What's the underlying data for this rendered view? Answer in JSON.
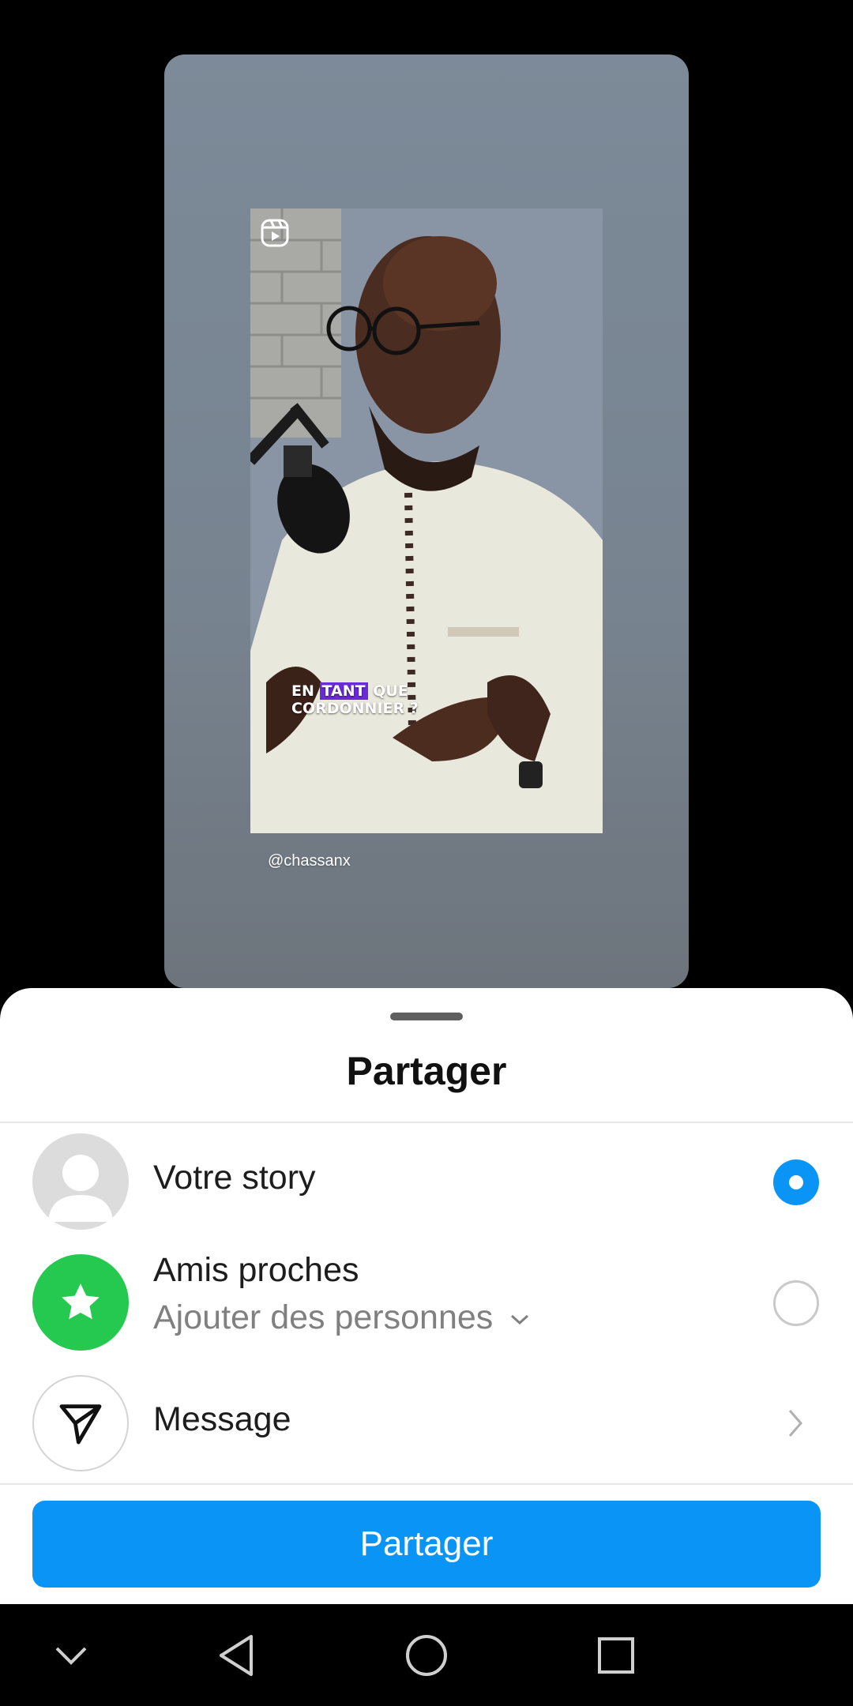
{
  "story_preview": {
    "caption_pre": "EN",
    "caption_highlight": "TANT",
    "caption_post": "QUE",
    "caption_line2": "CORDONNIER ?",
    "username": "@chassanx"
  },
  "sheet": {
    "title": "Partager",
    "options": [
      {
        "label": "Votre story",
        "selected": true,
        "icon": "person-icon"
      },
      {
        "label": "Amis proches",
        "sublabel": "Ajouter des personnes",
        "selected": false,
        "icon": "star-icon"
      },
      {
        "label": "Message",
        "icon": "send-icon"
      }
    ],
    "share_button": "Partager"
  },
  "colors": {
    "accent": "#0a95f6",
    "close_friends": "#25c94f"
  }
}
